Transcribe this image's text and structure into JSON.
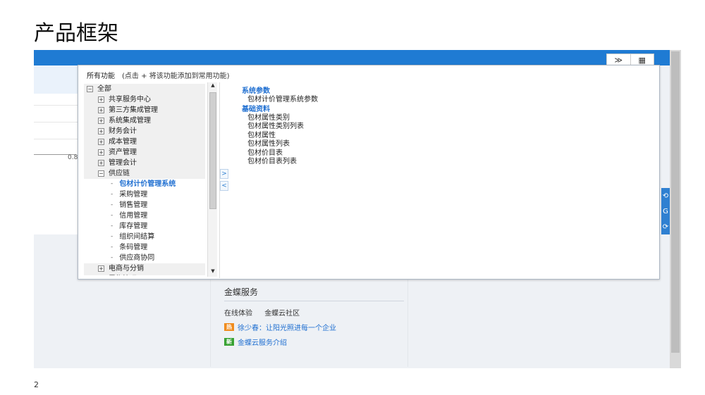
{
  "slide": {
    "title": "产品框架",
    "page_number": "2"
  },
  "topbar": {
    "btn_expand": "≫",
    "btn_grid": "▦"
  },
  "left_chart": {
    "axis_tick": "0.8"
  },
  "right_tabs": [
    "⟲",
    "G",
    "⟳"
  ],
  "popup": {
    "title": "所有功能",
    "hint": "(点击 + 将该功能添加到常用功能)",
    "tree": [
      {
        "label": "全部",
        "level": 0,
        "toggle": "⊟"
      },
      {
        "label": "共享服务中心",
        "level": 1,
        "toggle": "⊞"
      },
      {
        "label": "第三方集成管理",
        "level": 1,
        "toggle": "⊞"
      },
      {
        "label": "系统集成管理",
        "level": 1,
        "toggle": "⊞"
      },
      {
        "label": "财务会计",
        "level": 1,
        "toggle": "⊞"
      },
      {
        "label": "成本管理",
        "level": 1,
        "toggle": "⊞"
      },
      {
        "label": "资产管理",
        "level": 1,
        "toggle": "⊞"
      },
      {
        "label": "管理会计",
        "level": 1,
        "toggle": "⊞"
      },
      {
        "label": "供应链",
        "level": 1,
        "toggle": "⊟"
      },
      {
        "label": "包材计价管理系统",
        "level": 2,
        "toggle": "-",
        "active": true
      },
      {
        "label": "采购管理",
        "level": 2,
        "toggle": "-"
      },
      {
        "label": "销售管理",
        "level": 2,
        "toggle": "-"
      },
      {
        "label": "信用管理",
        "level": 2,
        "toggle": "-"
      },
      {
        "label": "库存管理",
        "level": 2,
        "toggle": "-"
      },
      {
        "label": "组织间结算",
        "level": 2,
        "toggle": "-"
      },
      {
        "label": "条码管理",
        "level": 2,
        "toggle": "-"
      },
      {
        "label": "供应商协同",
        "level": 2,
        "toggle": "-"
      },
      {
        "label": "电商与分销",
        "level": 1,
        "toggle": "⊞"
      },
      {
        "label": "零售管理",
        "level": 1,
        "toggle": "⊞"
      }
    ],
    "scroll_up": "▲",
    "scroll_down": "▼",
    "collapse_right": ">",
    "collapse_left": "<",
    "sections": [
      {
        "title": "系统参数",
        "items": [
          "包材计价管理系统参数"
        ]
      },
      {
        "title": "基础资料",
        "items": [
          "包材属性类别",
          "包材属性类别列表",
          "包材属性",
          "包材属性列表",
          "包材价目表",
          "包材价目表列表"
        ]
      }
    ]
  },
  "service": {
    "title": "金蝶服务",
    "links": [
      "在线体验",
      "金蝶云社区"
    ],
    "news": [
      {
        "badge": "热",
        "color": "#f08c1e",
        "text": "徐少春：让阳光照进每一个企业"
      },
      {
        "badge": "新",
        "color": "#3aa335",
        "text": "金蝶云服务介绍"
      }
    ]
  }
}
